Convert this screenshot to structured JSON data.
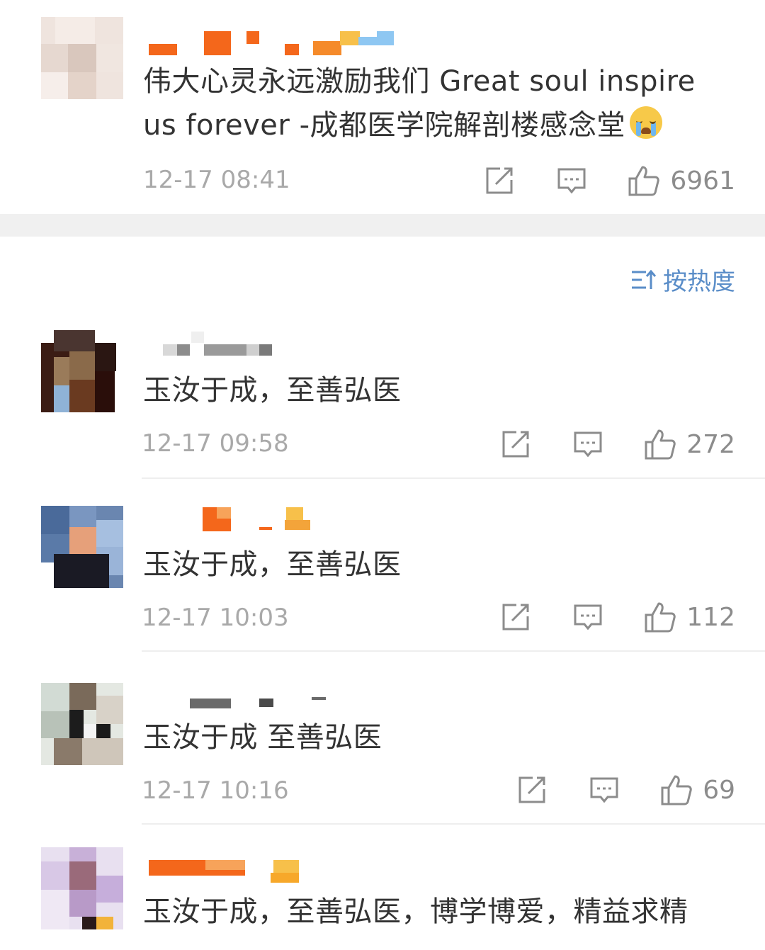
{
  "post": {
    "text": "伟大心灵永远激励我们 Great soul inspire us forever  -成都医学院解剖楼感念堂",
    "emoji": "crying-face",
    "time": "12-17 08:41",
    "likes": "6961"
  },
  "sort": {
    "label": "按热度",
    "icon": "sort-icon"
  },
  "comments": [
    {
      "text": "玉汝于成，至善弘医",
      "time": "12-17 09:58",
      "likes": "272"
    },
    {
      "text": "玉汝于成，至善弘医",
      "time": "12-17 10:03",
      "likes": "112"
    },
    {
      "text": "玉汝于成 至善弘医",
      "time": "12-17 10:16",
      "likes": "69"
    },
    {
      "text": "玉汝于成，至善弘医，博学博爱，精益求精"
    }
  ],
  "colors": {
    "meta": "#a9a9a9",
    "accent": "#5a8dc8",
    "divider": "#eeeeee",
    "gap": "#f0f0f0"
  }
}
